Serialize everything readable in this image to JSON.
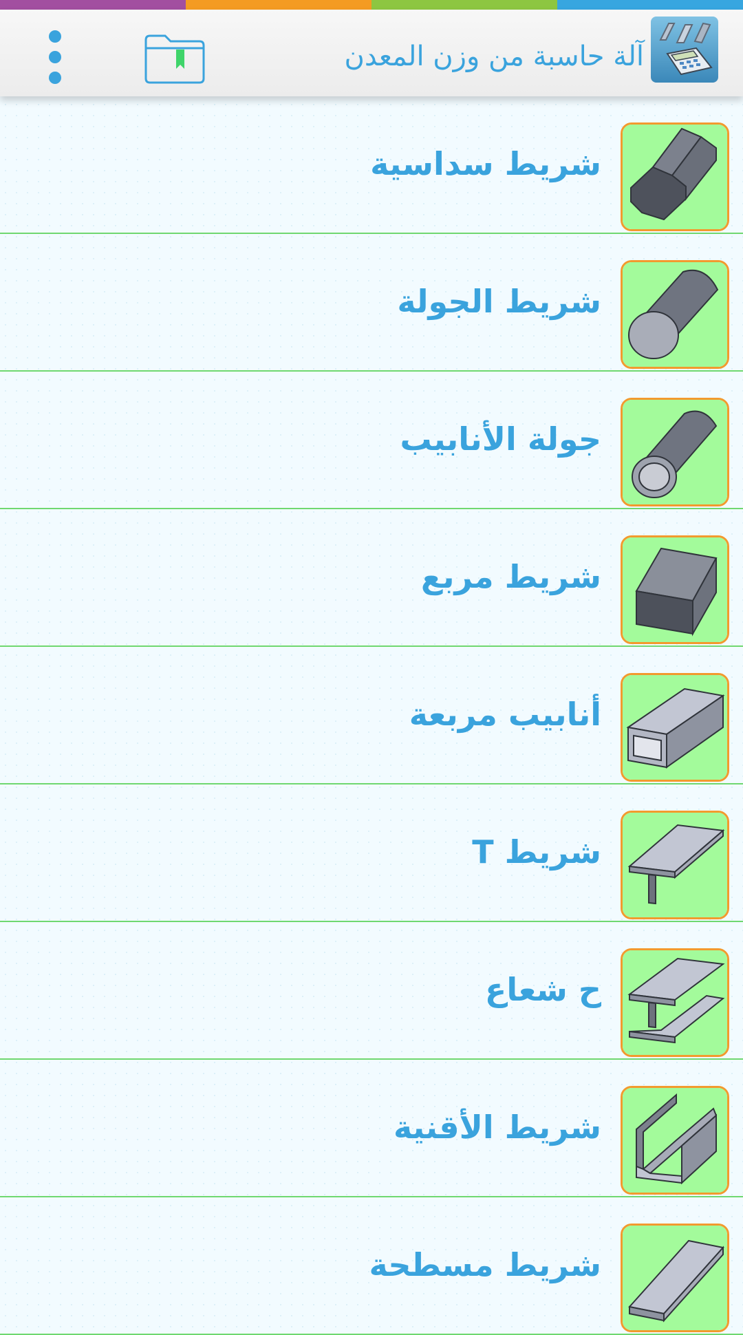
{
  "colors": {
    "stripe": [
      "#a24fa0",
      "#f49b22",
      "#8dc641",
      "#37a6e0"
    ],
    "accent": "#3aa3dd",
    "icon_bg": "#a3fb9b",
    "icon_border": "#f29a2e",
    "divider": "#6fd86f"
  },
  "header": {
    "title": "آلة حاسبة من وزن المعدن",
    "logo_icon": "metal-calculator-logo-icon",
    "folder_icon": "bookmark-folder-icon",
    "menu_icon": "overflow-menu-icon"
  },
  "items": [
    {
      "label": "شريط سداسية",
      "icon": "hexagon-bar-icon"
    },
    {
      "label": "شريط الجولة",
      "icon": "round-bar-icon"
    },
    {
      "label": "جولة الأنابيب",
      "icon": "round-pipe-icon"
    },
    {
      "label": "شريط مربع",
      "icon": "square-bar-icon"
    },
    {
      "label": "أنابيب مربعة",
      "icon": "square-tube-icon"
    },
    {
      "label": "شريط T",
      "icon": "t-bar-icon"
    },
    {
      "label": "ح شعاع",
      "icon": "h-beam-icon"
    },
    {
      "label": "شريط الأقنية",
      "icon": "channel-bar-icon"
    },
    {
      "label": "شريط مسطحة",
      "icon": "flat-bar-icon"
    }
  ]
}
